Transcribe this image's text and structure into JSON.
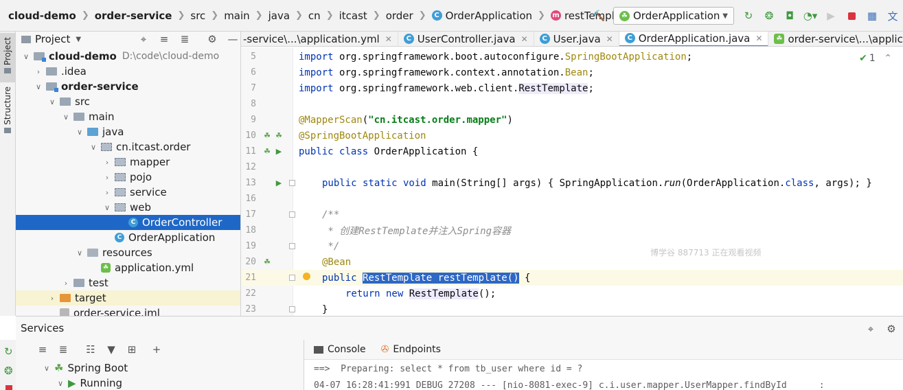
{
  "navbar": {
    "crumbs": [
      "cloud-demo",
      "order-service",
      "src",
      "main",
      "java",
      "cn",
      "itcast",
      "order",
      "OrderApplication",
      "restTemplate"
    ],
    "run_config": "OrderApplication"
  },
  "left_strip": {
    "project_tab": "Project",
    "structure_tab": "Structure"
  },
  "project_panel": {
    "title": "Project",
    "tree": [
      {
        "label": "cloud-demo",
        "path": "D:\\code\\cloud-demo"
      },
      {
        "label": ".idea"
      },
      {
        "label": "order-service"
      },
      {
        "label": "src"
      },
      {
        "label": "main"
      },
      {
        "label": "java"
      },
      {
        "label": "cn.itcast.order"
      },
      {
        "label": "mapper"
      },
      {
        "label": "pojo"
      },
      {
        "label": "service"
      },
      {
        "label": "web"
      },
      {
        "label": "OrderController"
      },
      {
        "label": "OrderApplication"
      },
      {
        "label": "resources"
      },
      {
        "label": "application.yml"
      },
      {
        "label": "test"
      },
      {
        "label": "target"
      },
      {
        "label": "order-service.iml"
      }
    ]
  },
  "editor_tabs": [
    {
      "label": "-service\\...\\application.yml"
    },
    {
      "label": "UserController.java"
    },
    {
      "label": "User.java"
    },
    {
      "label": "OrderApplication.java"
    },
    {
      "label": "order-service\\...\\application.yml"
    }
  ],
  "editor": {
    "inspection_count": "1",
    "watermark": "博学谷 887713 正在观看视频",
    "line_numbers": [
      "5",
      "6",
      "7",
      "8",
      "9",
      "10",
      "11",
      "12",
      "13",
      "16",
      "17",
      "18",
      "19",
      "20",
      "21",
      "22",
      "23"
    ],
    "code": {
      "l5_kw": "import ",
      "l5_pkg": "org.springframework.boot.autoconfigure.",
      "l5_cls": "SpringBootApplication",
      "l5_end": ";",
      "l6_kw": "import ",
      "l6_pkg": "org.springframework.context.annotation.",
      "l6_cls": "Bean",
      "l6_end": ";",
      "l7_kw": "import ",
      "l7_pkg": "org.springframework.web.client.",
      "l7_cls": "RestTemplate",
      "l7_end": ";",
      "l9_ann": "@MapperScan",
      "l9_p1": "(",
      "l9_str": "\"cn.itcast.order.mapper\"",
      "l9_p2": ")",
      "l10_ann": "@SpringBootApplication",
      "l11_kw": "public class ",
      "l11_rest": "OrderApplication {",
      "l13_kw": "public static void ",
      "l13_a": "main(String[] args) { SpringApplication.",
      "l13_run": "run",
      "l13_b": "(OrderApplication.",
      "l13_kw2": "class",
      "l13_c": ", args); }",
      "l17": "/**",
      "l18": " * 创建RestTemplate并注入Spring容器",
      "l19": " */",
      "l20_ann": "@Bean",
      "l21_kw": "public ",
      "l21_sel": "RestTemplate restTemplate()",
      "l21_end": " {",
      "l22_kw": "return new ",
      "l22_cls": "RestTemplate",
      "l22_end": "();",
      "l23": "}"
    }
  },
  "services": {
    "title": "Services",
    "tree": [
      {
        "label": "Spring Boot"
      },
      {
        "label": "Running"
      }
    ],
    "console_tab": "Console",
    "endpoints_tab": "Endpoints",
    "console_lines": [
      "==>  Preparing: select * from tb_user where id = ?",
      "04-07 16:28:41:991 DEBUG 27208 --- [nio-8081-exec-9] c.i.user.mapper.UserMapper.findById      :"
    ]
  },
  "colors": {
    "selection": "#1f67c6",
    "keyword": "#0033b3",
    "annotation": "#9e880d",
    "string": "#067d17",
    "caret_line": "#fcfae6"
  }
}
